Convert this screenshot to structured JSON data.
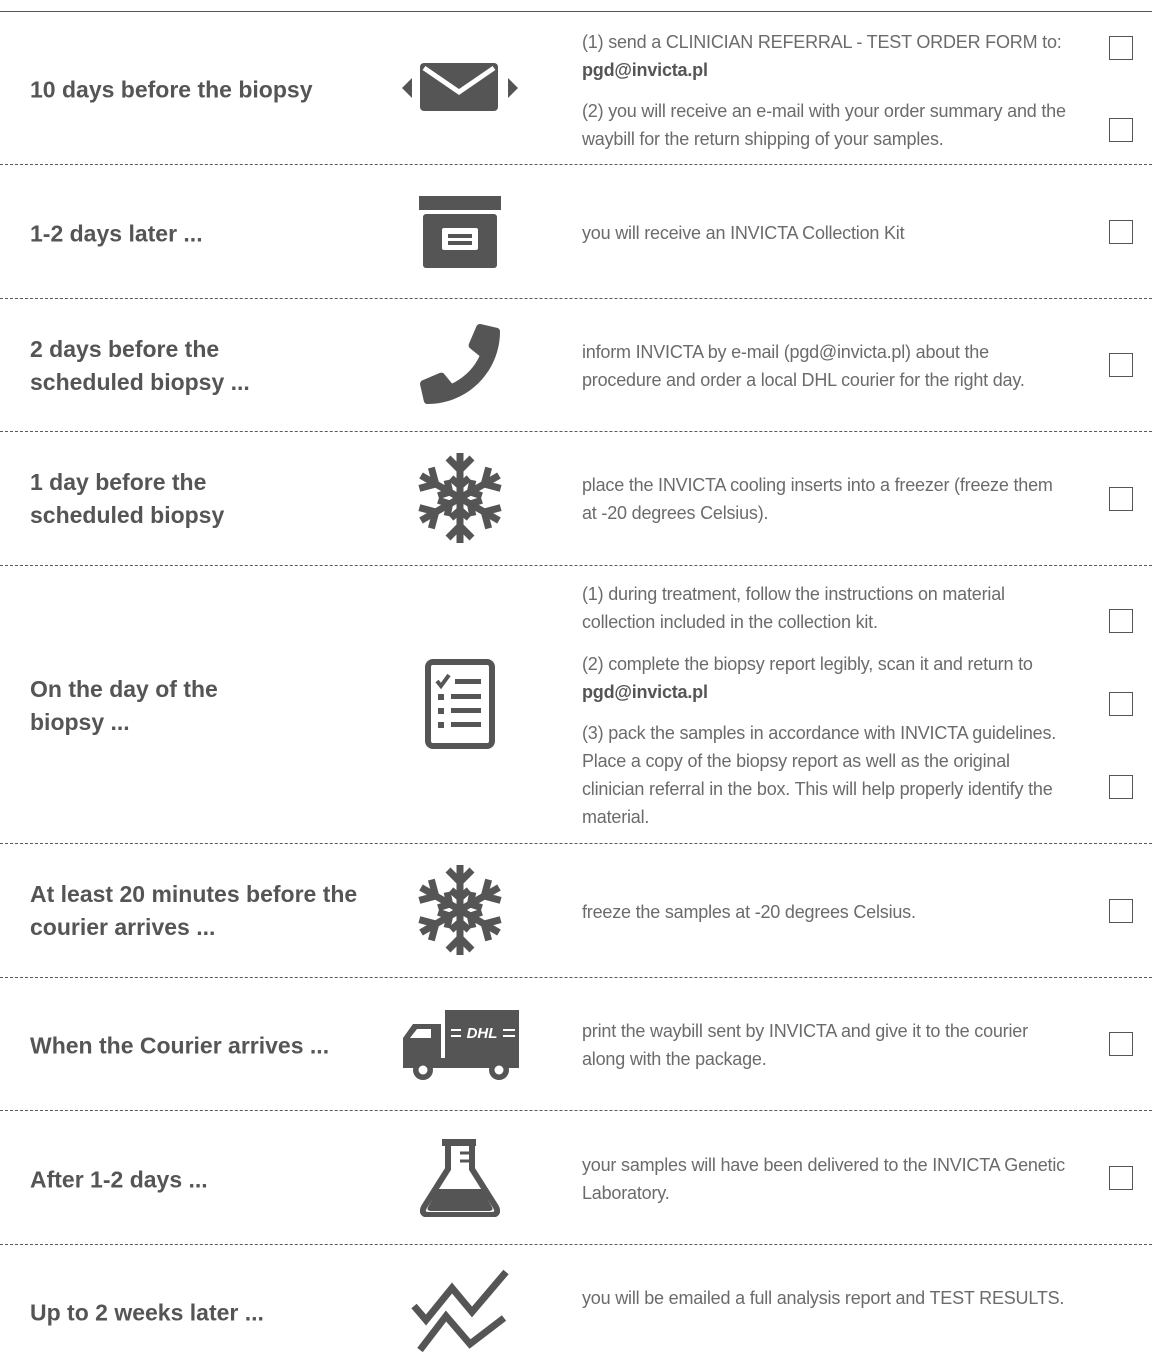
{
  "steps": [
    {
      "when": "10 days before the biopsy",
      "icon": "envelope-icon",
      "tasks": [
        {
          "text": "(1) send a CLINICIAN REFERRAL - TEST ORDER FORM to:",
          "bold": "pgd@invicta.pl"
        },
        {
          "text": "(2) you will receive an e-mail with your order summary and the waybill for the return shipping of your samples."
        }
      ]
    },
    {
      "when": "1-2 days later ...",
      "icon": "archive-box-icon",
      "tasks": [
        {
          "text": "you will receive an INVICTA Collection Kit"
        }
      ]
    },
    {
      "when": "2 days before the scheduled biopsy ...",
      "icon": "phone-icon",
      "tasks": [
        {
          "text": "inform INVICTA by e-mail (pgd@invicta.pl) about the procedure and order a local DHL courier for the right day."
        }
      ]
    },
    {
      "when": "1 day before the scheduled biopsy",
      "icon": "snowflake-icon",
      "tasks": [
        {
          "text": "place the INVICTA cooling inserts into a freezer (freeze them at -20 degrees Celsius)."
        }
      ]
    },
    {
      "when": "On the day of the biopsy ...",
      "icon": "checklist-icon",
      "tasks": [
        {
          "text": "(1) during treatment, follow the instructions on material collection included in the collection kit."
        },
        {
          "text": "(2) complete the biopsy report legibly, scan it and return to",
          "bold": "pgd@invicta.pl"
        },
        {
          "text": "(3) pack the samples in accordance with INVICTA guidelines. Place a copy of the biopsy report as well as the original clinician referral in the box. This will help properly identify the material."
        }
      ]
    },
    {
      "when": "At least 20 minutes before the courier arrives ...",
      "icon": "snowflake-icon",
      "tasks": [
        {
          "text": "freeze the samples at -20 degrees Celsius."
        }
      ]
    },
    {
      "when": "When the Courier arrives ...",
      "icon": "dhl-truck-icon",
      "truck_label": "DHL",
      "tasks": [
        {
          "text": "print the waybill sent by INVICTA and give it to the courier along with the package."
        }
      ]
    },
    {
      "when": "After 1-2 days ...",
      "icon": "flask-icon",
      "tasks": [
        {
          "text": "your samples will have been delivered to the INVICTA Genetic Laboratory."
        }
      ]
    },
    {
      "when": "Up to 2 weeks later ...",
      "icon": "trend-chart-icon",
      "tasks": [
        {
          "text": "you will be emailed a full analysis report and TEST RESULTS."
        }
      ]
    }
  ]
}
